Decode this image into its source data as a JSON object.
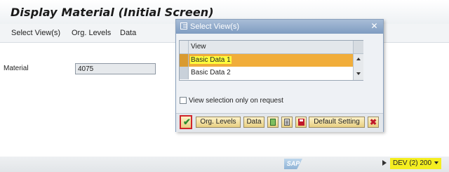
{
  "window": {
    "title": "Display Material (Initial Screen)"
  },
  "menu": {
    "items": [
      "Select View(s)",
      "Org. Levels",
      "Data"
    ]
  },
  "form": {
    "material_label": "Material",
    "material_value": "4075"
  },
  "dialog": {
    "title": "Select View(s)",
    "close_label": "✕",
    "table": {
      "header": "View",
      "rows": [
        "Basic Data 1",
        "Basic Data 2"
      ],
      "highlighted_row": 0
    },
    "checkbox_label": "View selection only on request",
    "buttons": {
      "confirm_icon": "checkmark-icon",
      "org_levels": "Org. Levels",
      "data": "Data",
      "select_all_icon": "select-all-icon",
      "deselect_all_icon": "deselect-all-icon",
      "save_icon": "save-icon",
      "default_setting": "Default Setting",
      "cancel_icon": "cancel-icon",
      "cancel_glyph": "✖"
    }
  },
  "status_bar": {
    "logo_text": "SAP",
    "system": "DEV (2) 200",
    "highlight_color": "#f4ee20"
  },
  "colors": {
    "selected_row": "#f1ad3a",
    "text_highlight": "#ffff3c",
    "confirm_outline": "#d1262c"
  }
}
